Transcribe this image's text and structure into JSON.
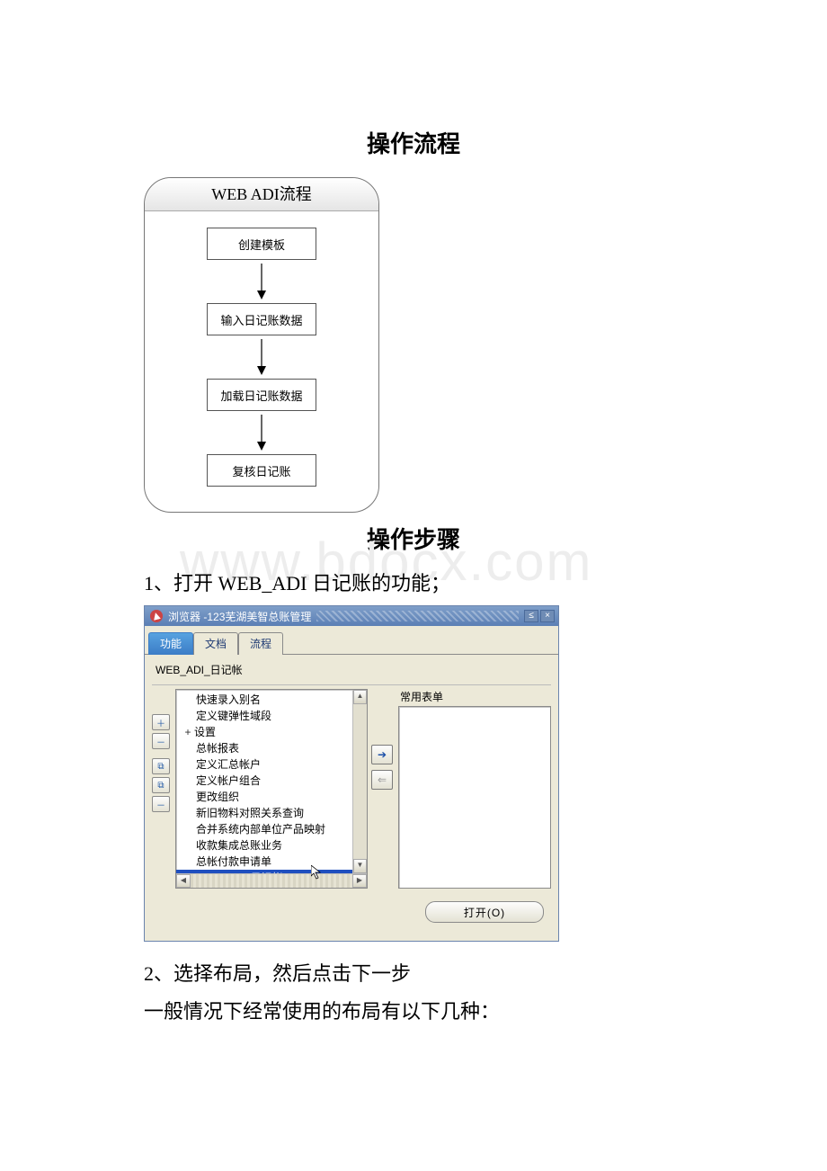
{
  "watermark": "www.bdocx.com",
  "heading1": "操作流程",
  "heading2": "操作步骤",
  "flowchart": {
    "title": "WEB ADI流程",
    "steps": [
      "创建模板",
      "输入日记账数据",
      "加载日记账数据",
      "复核日记账"
    ]
  },
  "step1": "1、打开 WEB_ADI 日记账的功能；",
  "step2": "2、选择布局，然后点击下一步",
  "step3": "一般情况下经常使用的布局有以下几种：",
  "dialog": {
    "title_prefix": "浏览器 - ",
    "title_suffix": "123芜湖美智总账管理",
    "tabs": [
      "功能",
      "文档",
      "流程"
    ],
    "breadcrumb": "WEB_ADI_日记帐",
    "right_label": "常用表单",
    "open_button": "打开(O)",
    "items": [
      "快速录入别名",
      "定义键弹性域段",
      "设置",
      "总帐报表",
      "定义汇总帐户",
      "定义帐户组合",
      "更改组织",
      "新旧物料对照关系查询",
      "合并系统内部单位产品映射",
      "收款集成总账业务",
      "总帐付款申请单",
      "WEB_ADI_日记帐"
    ],
    "selected_index": 11,
    "parent_index": 2
  }
}
